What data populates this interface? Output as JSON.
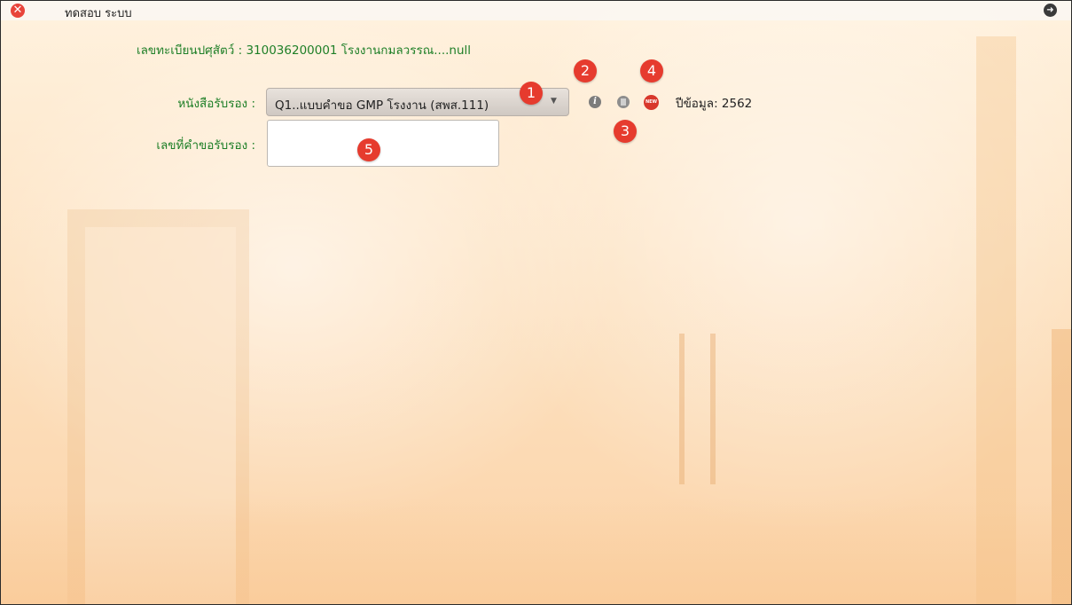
{
  "window": {
    "title": "ทดสอบ ระบบ",
    "close_icon": "close-icon",
    "nav_icon": "arrow-right-circle-icon"
  },
  "registration": {
    "text": "เลขทะเบียนปศุสัตว์ :  310036200001   โรงงานกมลวรรณ....null"
  },
  "form": {
    "certificate_label": "หนังสือรับรอง :",
    "certificate_value": "Q1..แบบคำขอ GMP โรงงาน (สพส.111)",
    "request_label": "เลขที่คำขอรับรอง :",
    "request_value": "",
    "year_text": "ปีข้อมูล: 2562"
  },
  "icons": {
    "info": "info-icon",
    "building": "building-icon",
    "new": "NEW"
  },
  "callouts": [
    "1",
    "2",
    "3",
    "4",
    "5"
  ],
  "colors": {
    "label_green": "#1e7f27",
    "callout_red": "#e63b2e"
  }
}
